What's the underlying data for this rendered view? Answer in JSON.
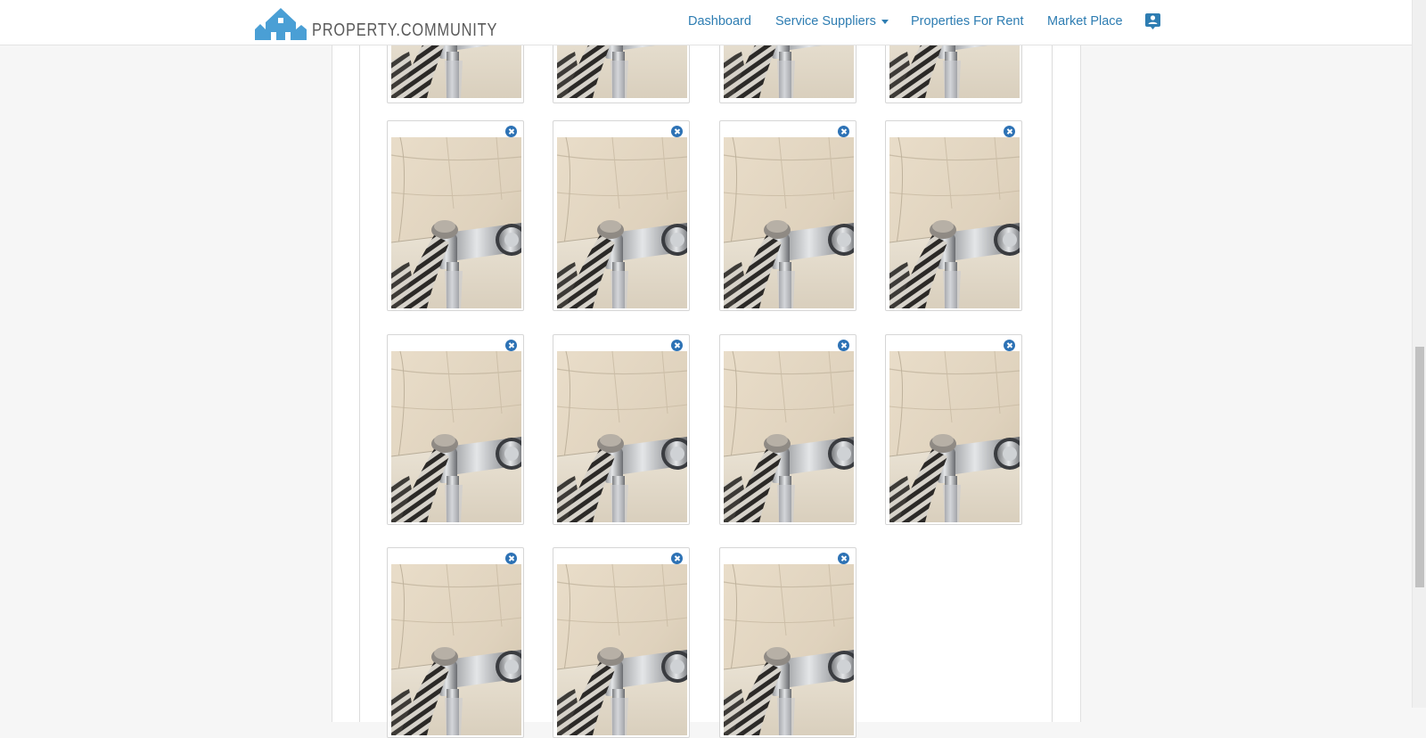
{
  "navbar": {
    "brand_text": "PROPERTY.COMMUNITY",
    "links": [
      {
        "label": "Dashboard"
      },
      {
        "label": "Service Suppliers"
      },
      {
        "label": "Properties For Rent"
      },
      {
        "label": "Market Place"
      }
    ],
    "profile_icon": "contact-card-icon"
  },
  "colors": {
    "brand": "#4a9fd5",
    "link": "#2e7db2",
    "remove_badge": "#2d72b5"
  },
  "gallery": {
    "remove_icon": "close-circle-icon",
    "image_subject": "bathtub faucet with coiled shower hose",
    "visible_thumbnail_count": 15
  }
}
